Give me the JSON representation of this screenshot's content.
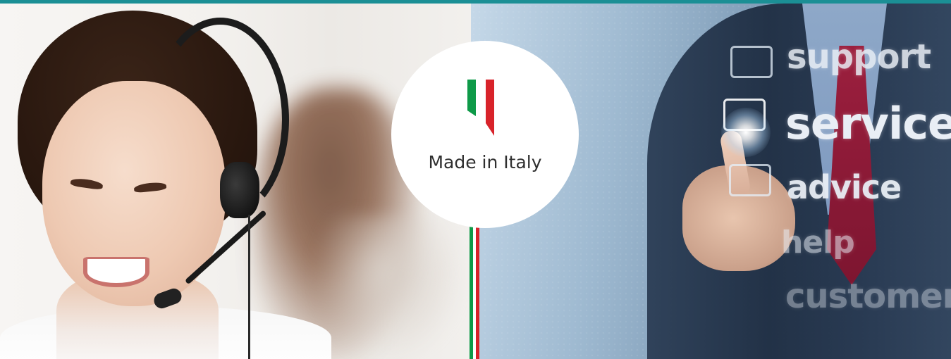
{
  "banner": {
    "badge_text": "Made in Italy",
    "service_words": [
      "support",
      "services",
      "advice",
      "help",
      "customer"
    ]
  },
  "colors": {
    "top_strip": "#1b8f95",
    "italy_green": "#0e9a48",
    "italy_white": "#ffffff",
    "italy_red": "#d8232a",
    "badge_background": "#ffffff",
    "badge_text": "#2f2f2f"
  },
  "icons": {
    "flag": "italian-flag-ribbon-icon",
    "left_photo": "call-center-operator-photo",
    "right_photo": "businessman-touchscreen-photo"
  }
}
